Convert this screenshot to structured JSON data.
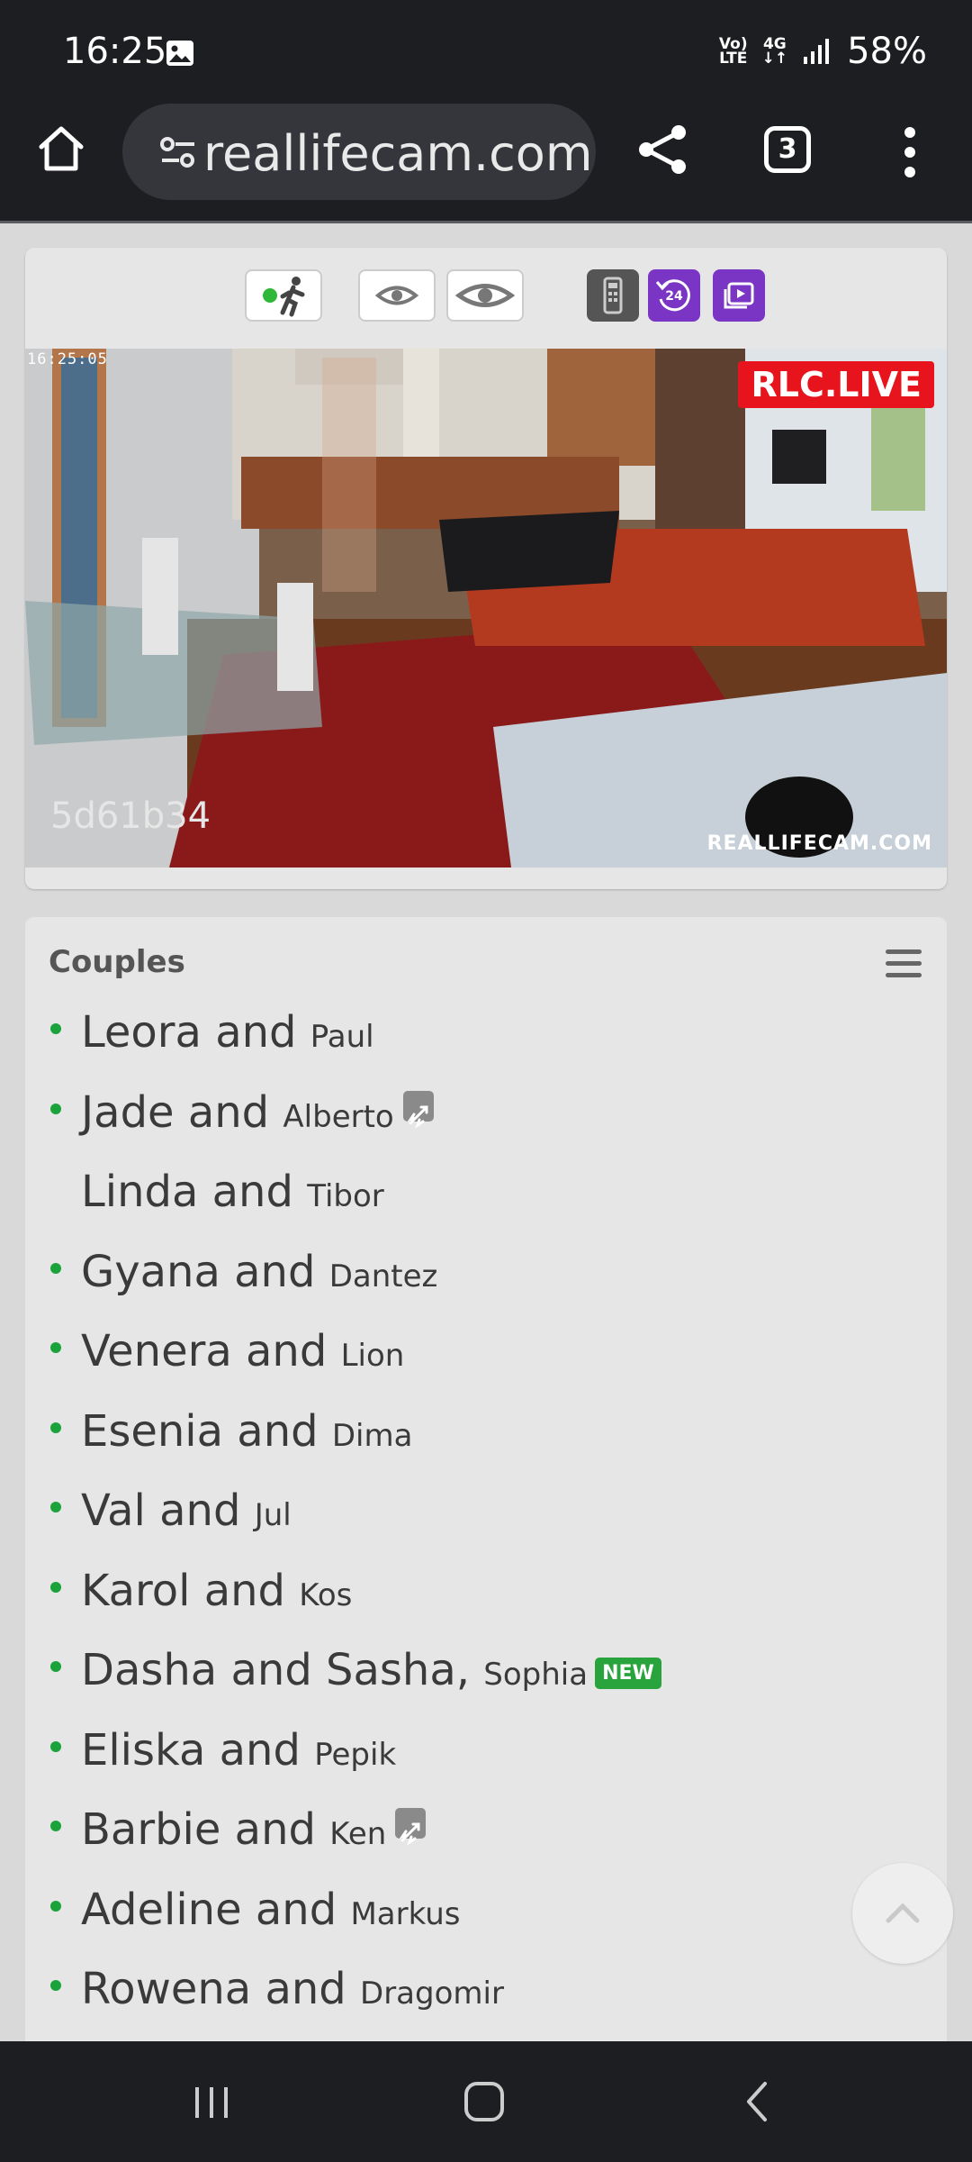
{
  "status_bar": {
    "time": "16:25",
    "network_top": "Vo)",
    "network_bottom": "LTE",
    "network_type": "4G",
    "battery": "58%"
  },
  "browser": {
    "url": "reallifecam.com/",
    "tab_count": "3"
  },
  "player": {
    "timestamp": "16:25:05",
    "live_badge": "RLC.LIVE",
    "camera_id": "5d61b34",
    "watermark": "REALLIFECAM.COM"
  },
  "list": {
    "title": "Couples",
    "items": [
      {
        "main": "Leora and",
        "sub": "Paul",
        "online": true,
        "travel": false,
        "new": false
      },
      {
        "main": "Jade and",
        "sub": "Alberto",
        "online": true,
        "travel": true,
        "new": false
      },
      {
        "main": "Linda and",
        "sub": "Tibor",
        "online": false,
        "travel": false,
        "new": false
      },
      {
        "main": "Gyana and",
        "sub": "Dantez",
        "online": true,
        "travel": false,
        "new": false
      },
      {
        "main": "Venera and",
        "sub": "Lion",
        "online": true,
        "travel": false,
        "new": false
      },
      {
        "main": "Esenia and",
        "sub": "Dima",
        "online": true,
        "travel": false,
        "new": false
      },
      {
        "main": "Val and",
        "sub": "Jul",
        "online": true,
        "travel": false,
        "new": false
      },
      {
        "main": "Karol and",
        "sub": "Kos",
        "online": true,
        "travel": false,
        "new": false
      },
      {
        "main": "Dasha and Sasha,",
        "sub": "Sophia",
        "online": true,
        "travel": false,
        "new": true
      },
      {
        "main": "Eliska and",
        "sub": "Pepik",
        "online": true,
        "travel": false,
        "new": false
      },
      {
        "main": "Barbie and",
        "sub": "Ken",
        "online": true,
        "travel": true,
        "new": false
      },
      {
        "main": "Adeline and",
        "sub": "Markus",
        "online": true,
        "travel": false,
        "new": false
      },
      {
        "main": "Rowena and",
        "sub": "Dragomir",
        "online": true,
        "travel": false,
        "new": false
      }
    ],
    "new_badge": "NEW"
  },
  "colors": {
    "online": "#1aa33a",
    "live_red": "#e8141d",
    "purple": "#7a35c4",
    "chrome_dark": "#1d1e22"
  }
}
